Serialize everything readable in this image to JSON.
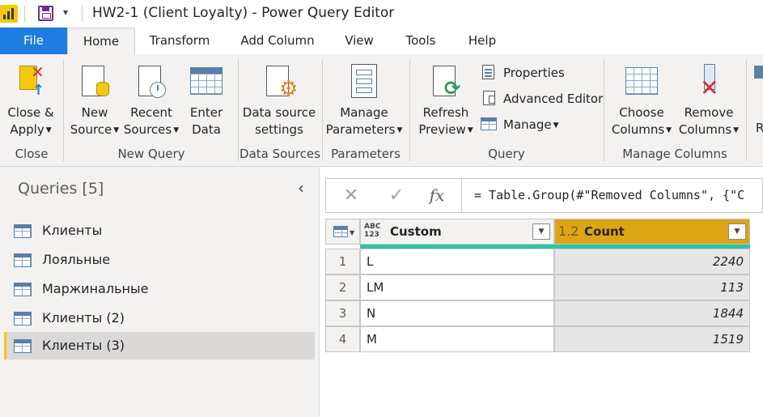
{
  "window": {
    "title": "HW2-1 (Client Loyalty) - Power Query Editor",
    "qat_dropdown": "▾"
  },
  "tabs": [
    "File",
    "Home",
    "Transform",
    "Add Column",
    "View",
    "Tools",
    "Help"
  ],
  "ribbon": {
    "close_apply": {
      "line1": "Close &",
      "line2": "Apply"
    },
    "new_source": {
      "line1": "New",
      "line2": "Source"
    },
    "recent_sources": {
      "line1": "Recent",
      "line2": "Sources"
    },
    "enter_data": {
      "line1": "Enter",
      "line2": "Data"
    },
    "data_source_settings": {
      "line1": "Data source",
      "line2": "settings"
    },
    "manage_parameters": {
      "line1": "Manage",
      "line2": "Parameters"
    },
    "refresh_preview": {
      "line1": "Refresh",
      "line2": "Preview"
    },
    "properties": "Properties",
    "advanced_editor": "Advanced Editor",
    "manage": "Manage",
    "choose_columns": {
      "line1": "Choose",
      "line2": "Columns"
    },
    "remove_columns": {
      "line1": "Remove",
      "line2": "Columns"
    },
    "partial_next": "R",
    "groups": {
      "close": "Close",
      "new_query": "New Query",
      "data_sources": "Data Sources",
      "parameters": "Parameters",
      "query": "Query",
      "manage_columns": "Manage Columns"
    }
  },
  "queries_pane": {
    "title": "Queries [5]",
    "items": [
      "Клиенты",
      "Лояльные",
      "Маржинальные",
      "Клиенты (2)",
      "Клиенты (3)"
    ],
    "selected_index": 4
  },
  "formula_bar": {
    "cancel": "✕",
    "commit": "✓",
    "fx": "fx",
    "text": "= Table.Group(#\"Removed Columns\", {\"C"
  },
  "grid": {
    "columns": [
      {
        "type": "ABC\n123",
        "name": "Custom"
      },
      {
        "type": "1.2",
        "name": "Count"
      }
    ],
    "rows": [
      {
        "index": "1",
        "custom": "L",
        "count": "2240"
      },
      {
        "index": "2",
        "custom": "LM",
        "count": "113"
      },
      {
        "index": "3",
        "custom": "N",
        "count": "1844"
      },
      {
        "index": "4",
        "custom": "M",
        "count": "1519"
      }
    ]
  },
  "colors": {
    "file_tab": "#1e7ce0",
    "accent_yellow": "#f2c811",
    "count_header": "#dba514",
    "quality_bar": "#2ec4a8"
  }
}
